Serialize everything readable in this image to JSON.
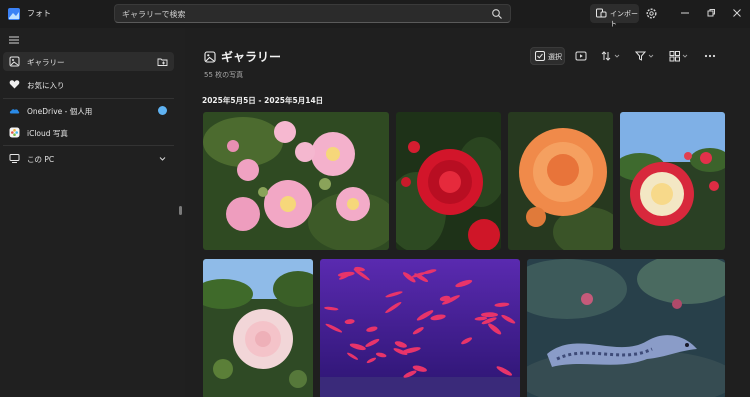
{
  "app": {
    "name": "フォト"
  },
  "search": {
    "placeholder": "ギャラリーで検索"
  },
  "titlebar": {
    "import_label": "インポート"
  },
  "sidebar": {
    "items": [
      {
        "label": "ギャラリー",
        "icon": "gallery-icon",
        "active": true
      },
      {
        "label": "お気に入り",
        "icon": "heart-icon"
      },
      {
        "label": "OneDrive - 個人用",
        "icon": "onedrive-icon"
      },
      {
        "label": "iCloud 写真",
        "icon": "icloud-icon"
      },
      {
        "label": "この PC",
        "icon": "pc-icon"
      }
    ]
  },
  "main": {
    "title": "ギャラリー",
    "photo_count": "55 枚の写真",
    "select_label": "選択",
    "date_range": "2025年5月5日 - 2025年5月14日"
  },
  "colors": {
    "accent": "#5fb2f2",
    "background": "#202020"
  },
  "photos": [
    "pink-climbing-roses",
    "red-rose",
    "orange-rose",
    "red-white-rose",
    "white-pink-rose",
    "aquarium-red-fish",
    "aquarium-moray-eel"
  ]
}
